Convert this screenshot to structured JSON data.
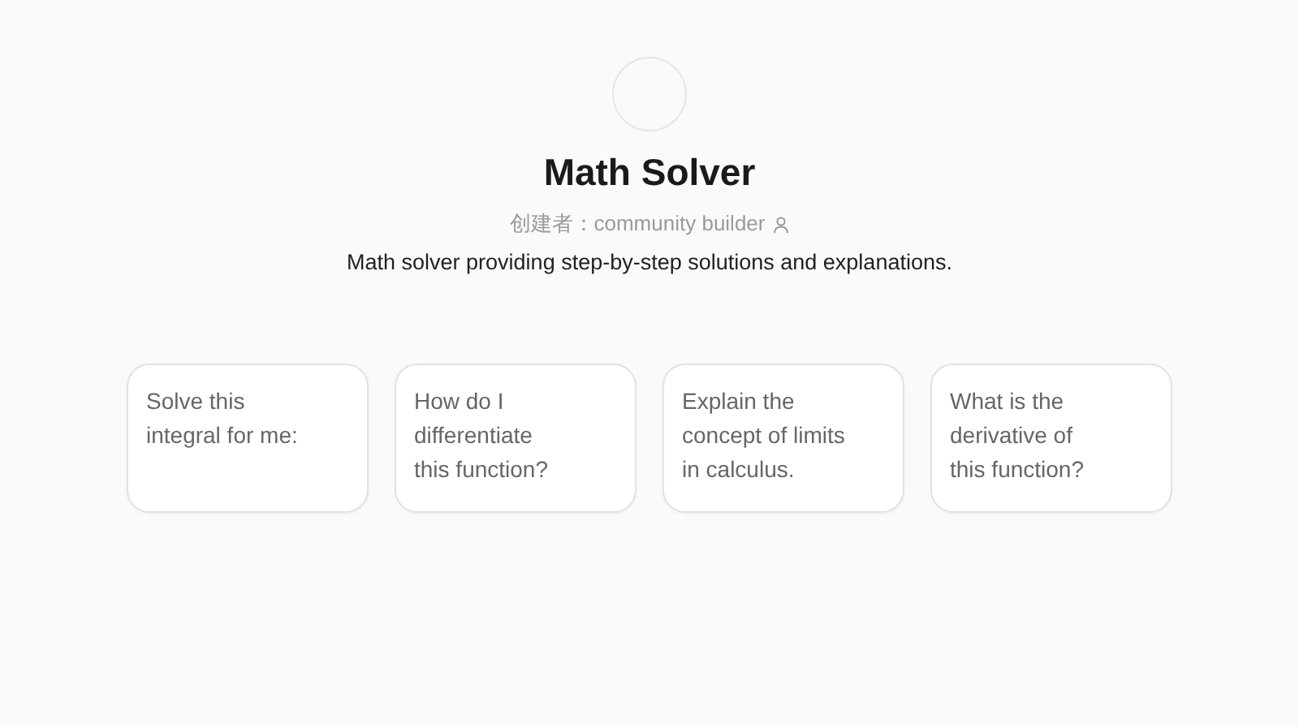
{
  "bot": {
    "name": "Math Solver",
    "creator_label": "创建者：community builder",
    "description": "Math solver providing step-by-step solutions and explanations."
  },
  "suggestions": [
    {
      "text": "Solve this\nintegral for me:"
    },
    {
      "text": "How do I\ndifferentiate\nthis function?"
    },
    {
      "text": "Explain the\nconcept of limits\nin calculus."
    },
    {
      "text": "What is the\nderivative of\nthis function?"
    }
  ]
}
